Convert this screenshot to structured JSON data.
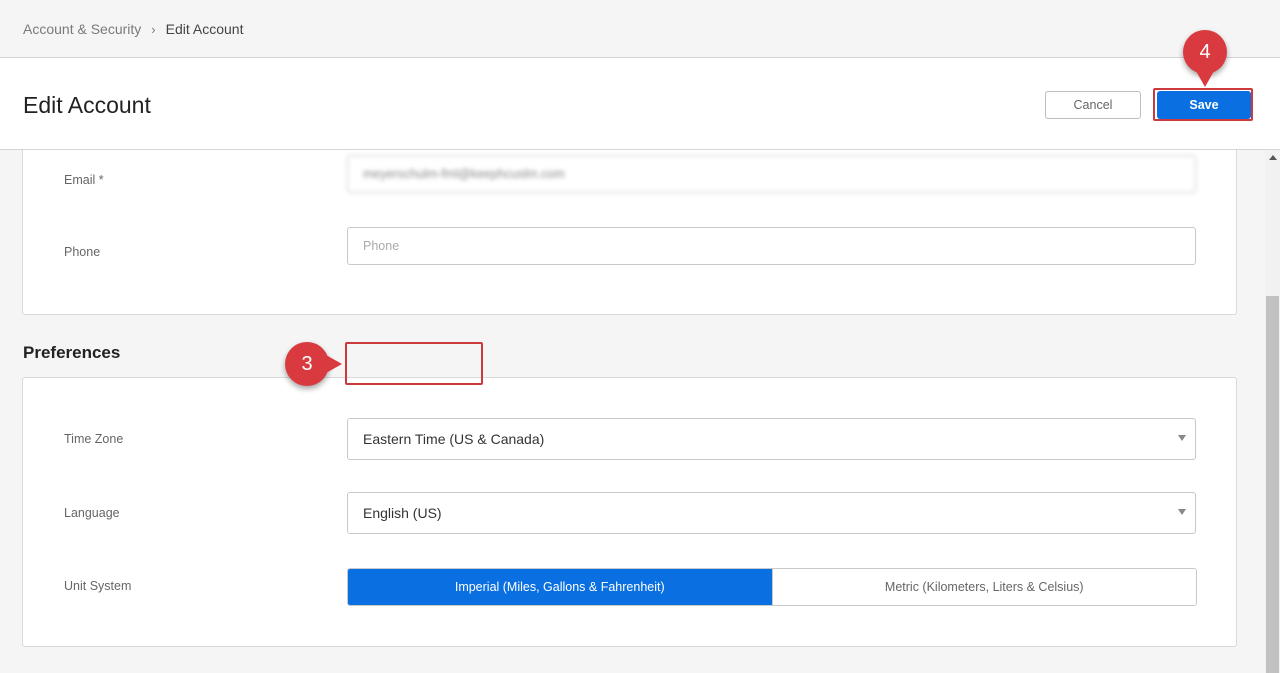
{
  "breadcrumb": {
    "parent": "Account & Security",
    "separator": "›",
    "current": "Edit Account"
  },
  "header": {
    "title": "Edit Account",
    "cancel_label": "Cancel",
    "save_label": "Save"
  },
  "contact": {
    "email_label": "Email *",
    "email_value": "meyerschulm-fml@keephcuslm.com",
    "phone_label": "Phone",
    "phone_placeholder": "Phone"
  },
  "preferences": {
    "section_title": "Preferences",
    "time_zone_label": "Time Zone",
    "time_zone_value": "Eastern Time (US & Canada)",
    "language_label": "Language",
    "language_value": "English (US)",
    "unit_system_label": "Unit System",
    "unit_options": [
      "Imperial (Miles, Gallons & Fahrenheit)",
      "Metric (Kilometers, Liters & Celsius)"
    ],
    "unit_selected": "Imperial (Miles, Gallons & Fahrenheit)"
  },
  "callouts": {
    "language_step": "3",
    "save_step": "4"
  },
  "colors": {
    "accent": "#0a6fe0",
    "callout": "#d83a3f"
  },
  "icons": {
    "breadcrumb_separator": "chevron-right-icon",
    "select_caret": "caret-down-icon",
    "scroll_up": "scroll-up-arrow-icon"
  }
}
